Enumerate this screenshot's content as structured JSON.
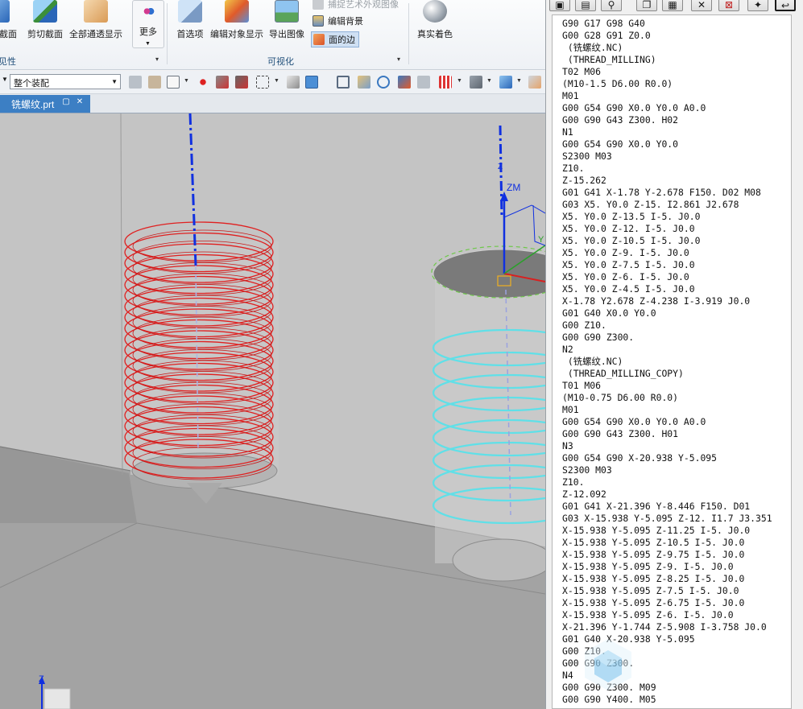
{
  "ribbon": {
    "buttons": [
      {
        "label": "截面"
      },
      {
        "label": "剪切截面"
      },
      {
        "label": "全部通透显示"
      },
      {
        "label": "更多"
      },
      {
        "label": "首选项"
      },
      {
        "label": "编辑对象显示"
      },
      {
        "label": "导出图像"
      },
      {
        "label": "真实着色"
      }
    ],
    "small_items": [
      {
        "label": "捕捉艺术外观图像"
      },
      {
        "label": "编辑背景"
      },
      {
        "label": "面的边"
      }
    ],
    "groups": {
      "visibility": "见性",
      "visualize": "可视化"
    }
  },
  "toolbar": {
    "assembly_select": "整个装配"
  },
  "document_tab": {
    "title": "铣螺纹.prt"
  },
  "viewport": {
    "axis_labels": {
      "zm": "ZM",
      "y": "Y",
      "z": "Z",
      "z_small": "Z"
    }
  },
  "colors": {
    "thread_red": "#e02020",
    "thread_cyan": "#5fe0e8",
    "tab_blue": "#3c7fc4",
    "axis_blue": "#1030e0"
  },
  "nc_program": {
    "lines": [
      "G90 G17 G98 G40",
      "G00 G28 G91 Z0.0",
      " (铣螺纹.NC)",
      " (THREAD_MILLING)",
      "T02 M06",
      "(M10-1.5 D6.00 R0.0)",
      "M01",
      "G00 G54 G90 X0.0 Y0.0 A0.0",
      "G00 G90 G43 Z300. H02",
      "N1",
      "G00 G54 G90 X0.0 Y0.0",
      "S2300 M03",
      "Z10.",
      "Z-15.262",
      "G01 G41 X-1.78 Y-2.678 F150. D02 M08",
      "G03 X5. Y0.0 Z-15. I2.861 J2.678",
      "X5. Y0.0 Z-13.5 I-5. J0.0",
      "X5. Y0.0 Z-12. I-5. J0.0",
      "X5. Y0.0 Z-10.5 I-5. J0.0",
      "X5. Y0.0 Z-9. I-5. J0.0",
      "X5. Y0.0 Z-7.5 I-5. J0.0",
      "X5. Y0.0 Z-6. I-5. J0.0",
      "X5. Y0.0 Z-4.5 I-5. J0.0",
      "X-1.78 Y2.678 Z-4.238 I-3.919 J0.0",
      "G01 G40 X0.0 Y0.0",
      "G00 Z10.",
      "G00 G90 Z300.",
      "N2",
      " (铣螺纹.NC)",
      " (THREAD_MILLING_COPY)",
      "T01 M06",
      "(M10-0.75 D6.00 R0.0)",
      "M01",
      "G00 G54 G90 X0.0 Y0.0 A0.0",
      "G00 G90 G43 Z300. H01",
      "N3",
      "G00 G54 G90 X-20.938 Y-5.095",
      "S2300 M03",
      "Z10.",
      "Z-12.092",
      "G01 G41 X-21.396 Y-8.446 F150. D01",
      "G03 X-15.938 Y-5.095 Z-12. I1.7 J3.351",
      "X-15.938 Y-5.095 Z-11.25 I-5. J0.0",
      "X-15.938 Y-5.095 Z-10.5 I-5. J0.0",
      "X-15.938 Y-5.095 Z-9.75 I-5. J0.0",
      "X-15.938 Y-5.095 Z-9. I-5. J0.0",
      "X-15.938 Y-5.095 Z-8.25 I-5. J0.0",
      "X-15.938 Y-5.095 Z-7.5 I-5. J0.0",
      "X-15.938 Y-5.095 Z-6.75 I-5. J0.0",
      "X-15.938 Y-5.095 Z-6. I-5. J0.0",
      "X-21.396 Y-1.744 Z-5.908 I-3.758 J0.0",
      "G01 G40 X-20.938 Y-5.095",
      "G00 Z10.",
      "G00 G90 Z300.",
      "N4",
      "G00 G90 Z300. M09",
      "G00 G90 Y400. M05"
    ]
  }
}
